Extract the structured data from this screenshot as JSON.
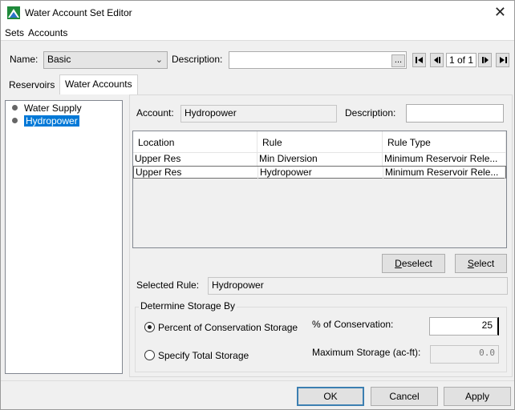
{
  "window": {
    "title": "Water Account Set Editor"
  },
  "menu": {
    "sets": "Sets",
    "accounts": "Accounts"
  },
  "toolbar": {
    "name_label": "Name:",
    "name_value": "Basic",
    "description_label": "Description:",
    "description_value": "",
    "browse_label": "...",
    "page_indicator": "1 of 1"
  },
  "tabs": [
    {
      "label": "Reservoirs"
    },
    {
      "label": "Water Accounts"
    }
  ],
  "tree": {
    "items": [
      {
        "label": "Water Supply"
      },
      {
        "label": "Hydropower"
      }
    ]
  },
  "account": {
    "account_label": "Account:",
    "account_value": "Hydropower",
    "description_label": "Description:",
    "description_value": ""
  },
  "table": {
    "columns": [
      "Location",
      "Rule",
      "Rule Type"
    ],
    "rows": [
      [
        "Upper Res",
        "Min Diversion",
        "Minimum Reservoir Rele..."
      ],
      [
        "Upper Res",
        "Hydropower",
        "Minimum Reservoir Rele..."
      ]
    ]
  },
  "actions": {
    "deselect": "Deselect",
    "select": "Select"
  },
  "selected_rule": {
    "label": "Selected Rule:",
    "value": "Hydropower"
  },
  "storage": {
    "group_title": "Determine Storage By",
    "option_percent": "Percent of Conservation Storage",
    "option_total": "Specify Total Storage",
    "percent_label": "% of Conservation:",
    "percent_value": "25",
    "max_label": "Maximum Storage (ac-ft):",
    "max_value": "0.0"
  },
  "footer": {
    "ok": "OK",
    "cancel": "Cancel",
    "apply": "Apply"
  },
  "colors": {
    "selection": "#0078d7",
    "default_button_border": "#3c7fb1"
  }
}
